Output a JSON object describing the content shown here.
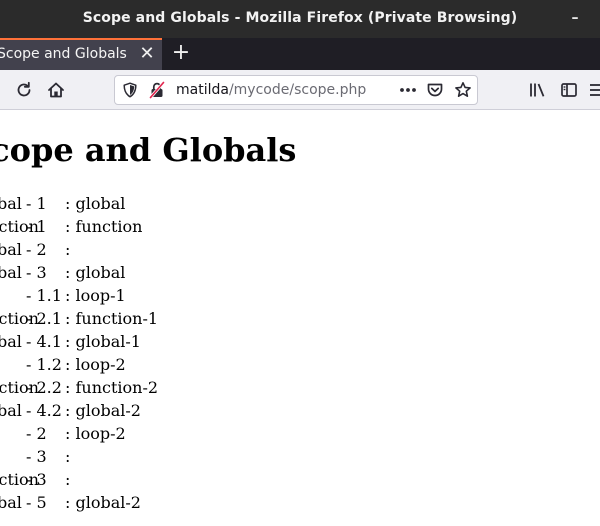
{
  "window": {
    "title": "Scope and Globals - Mozilla Firefox (Private Browsing)",
    "minimize_glyph": "–"
  },
  "tabs": [
    {
      "label": "Scope and Globals",
      "close_glyph": "✕"
    }
  ],
  "newtab_glyph": "+",
  "urlbar": {
    "host": "matilda",
    "path": "/mycode/scope.php"
  },
  "icons": {
    "reload": "reload-icon",
    "home": "home-icon",
    "tracking": "shield-icon",
    "insecure": "insecure-lock-icon",
    "page_actions": "more-actions-icon",
    "pocket": "pocket-icon",
    "bookmark": "star-icon",
    "library": "library-icon",
    "sidebar": "sidebar-icon",
    "menu": "hamburger-menu-icon"
  },
  "colors": {
    "titlebar": "#2b2b2b",
    "tabstrip": "#1f1e25",
    "active_tab": "#42414d",
    "tab_accent": "#ff7139",
    "navbar": "#f0f0f4",
    "insecure_red": "#e22850"
  },
  "page": {
    "heading": "Scope and Globals",
    "rows": [
      {
        "scope": "global",
        "num": "- 1",
        "value": ": global"
      },
      {
        "scope": "function",
        "num": "- 1",
        "value": ": function"
      },
      {
        "scope": "global",
        "num": "- 2",
        "value": ":"
      },
      {
        "scope": "global",
        "num": "- 3",
        "value": ": global"
      },
      {
        "scope": "",
        "num": "- 1.1",
        "value": ": loop-1"
      },
      {
        "scope": "function",
        "num": "- 2.1",
        "value": ": function-1"
      },
      {
        "scope": "global",
        "num": "- 4.1",
        "value": ": global-1"
      },
      {
        "scope": "",
        "num": "- 1.2",
        "value": ": loop-2"
      },
      {
        "scope": "function",
        "num": "- 2.2",
        "value": ": function-2"
      },
      {
        "scope": "global",
        "num": "- 4.2",
        "value": ": global-2"
      },
      {
        "scope": "",
        "num": "- 2",
        "value": ": loop-2"
      },
      {
        "scope": "",
        "num": "- 3",
        "value": ":"
      },
      {
        "scope": "function",
        "num": "- 3",
        "value": ":"
      },
      {
        "scope": "global",
        "num": "- 5",
        "value": ": global-2"
      }
    ]
  }
}
